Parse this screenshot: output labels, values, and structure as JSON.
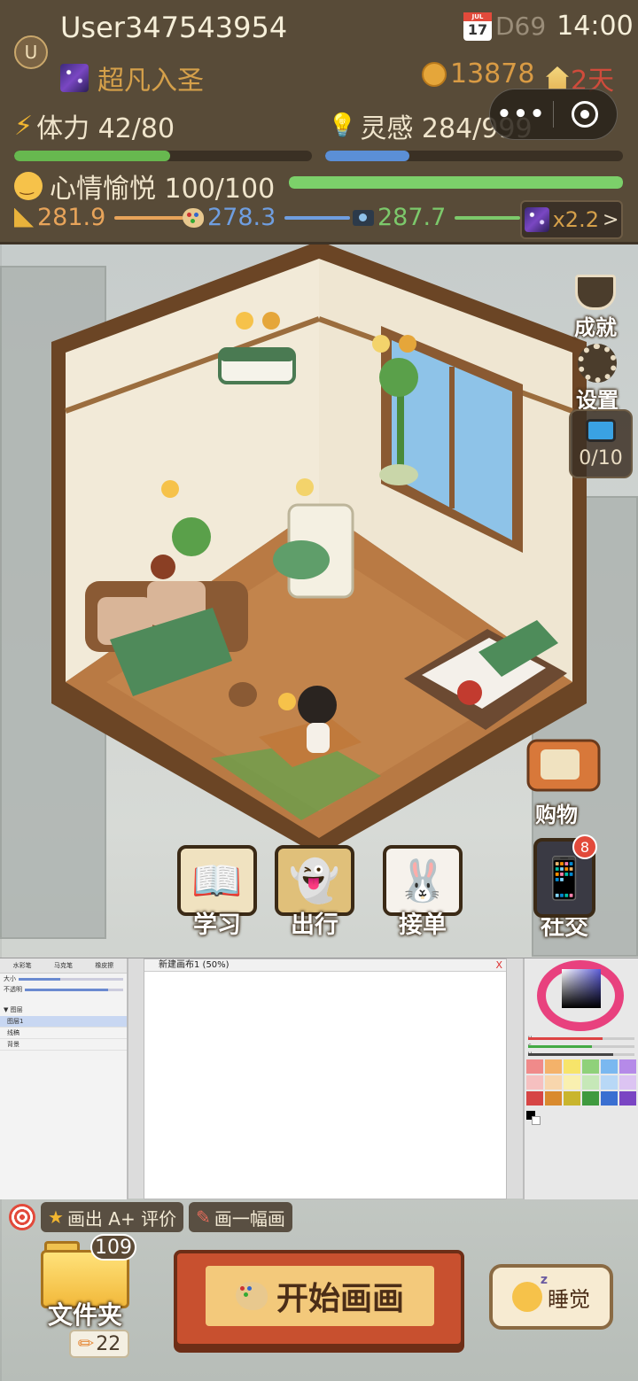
{
  "hud": {
    "avatar_letter": "U",
    "username": "User347543954",
    "title": "超凡入圣",
    "calendar_day": "17",
    "day_label": "D69",
    "time": "14:00",
    "coins": "13878",
    "days_left": "2天",
    "stamina_label": "体力 42/80",
    "stamina_fraction": 0.525,
    "inspiration_label": "灵感 284/999",
    "inspiration_fraction": 0.284,
    "mood_label": "心情愉悦 100/100",
    "mood_fraction": 1.0,
    "skills": [
      {
        "value": "281.9",
        "color": "#e8a45a"
      },
      {
        "value": "278.3",
        "color": "#6f9ee0"
      },
      {
        "value": "287.7",
        "color": "#7cc96b"
      }
    ],
    "multiplier": "x2.2",
    "chevron": ">"
  },
  "capsule": {
    "dots": "•••"
  },
  "side_buttons": {
    "achievement": "成就",
    "settings": "设置",
    "tv_count": "0/10",
    "shop": "购物"
  },
  "actions": [
    {
      "label": "学习",
      "icon": "book-icon",
      "glyph": "📖"
    },
    {
      "label": "出行",
      "icon": "ghost-icon",
      "glyph": "👻"
    },
    {
      "label": "接单",
      "icon": "bunny-icon",
      "glyph": "🐰"
    },
    {
      "label": "社交",
      "icon": "phone-icon",
      "glyph": "📱",
      "badge": "8"
    }
  ],
  "paint_app": {
    "tabs": [
      "水彩笔",
      "马克笔",
      "橡皮擦"
    ],
    "size_label": "大小",
    "opacity_label": "不透明",
    "size_fraction": 0.4,
    "opacity_fraction": 0.85,
    "layers_header": "▼ 图层",
    "layers": [
      "图层1",
      "线稿",
      "背景"
    ],
    "canvas_title": "新建画布1 (50%)",
    "close": "X",
    "hsv_labels": [
      "H",
      "S",
      "V"
    ],
    "swatches": [
      "#f08a8a",
      "#f4b26a",
      "#f7e46a",
      "#8fd17a",
      "#7ab8f0",
      "#b58ae8",
      "#f6c0c0",
      "#f8d6ad",
      "#f9f0b0",
      "#c6e8b8",
      "#b8d8f6",
      "#dcc4f2",
      "#d64545",
      "#d98a2e",
      "#c9b52e",
      "#3f9a3f",
      "#3a6fd1",
      "#7a45c3"
    ]
  },
  "bottom": {
    "task_primary": "画出 A+ 评价",
    "task_secondary": "画一幅画",
    "folder_count": "109",
    "folder_label": "文件夹",
    "pencil_count": "22",
    "start_label": "开始画画",
    "sleep_label": "睡觉"
  }
}
